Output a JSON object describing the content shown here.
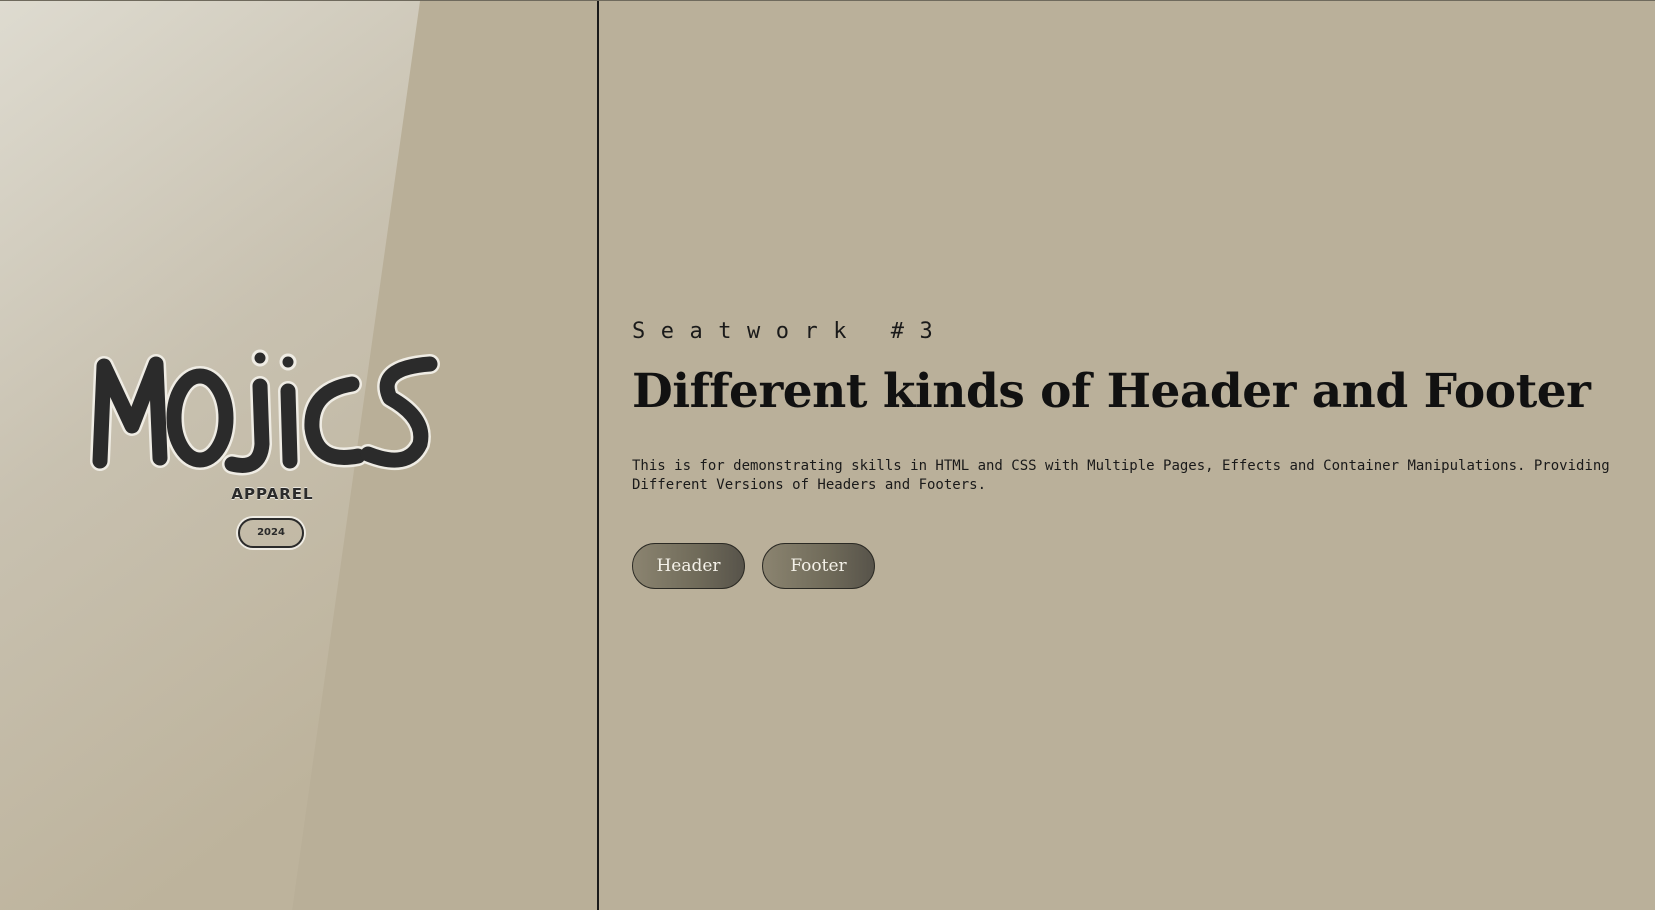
{
  "brand": {
    "logo_word": "MOJICS",
    "sub": "APPAREL",
    "year": "2024"
  },
  "hero": {
    "eyebrow": "Seatwork #3",
    "title": "Different kinds of Header and Footer",
    "description_line1": "This is for demonstrating skills in HTML and CSS with Multiple Pages, Effects and Container Manipulations. Providing",
    "description_line2": "Different Versions of Headers and Footers."
  },
  "buttons": {
    "header_label": "Header",
    "footer_label": "Footer"
  },
  "colors": {
    "background": "#bab09a",
    "divider": "#1a1a1a",
    "button_gradient_start": "#8b8470",
    "button_gradient_end": "#57534a",
    "button_text": "#f4f1e8"
  }
}
